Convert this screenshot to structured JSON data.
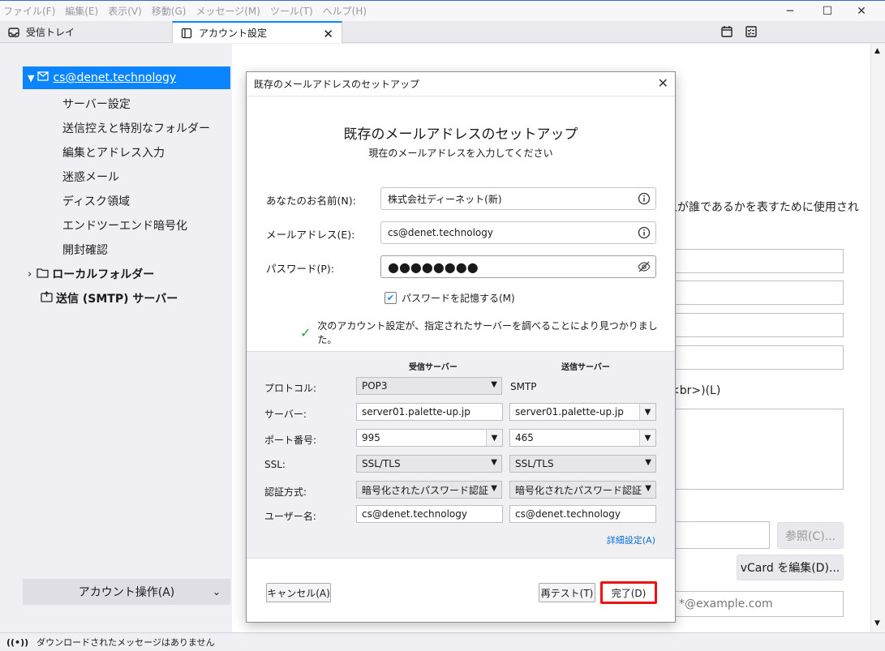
{
  "menu": [
    "ファイル(F)",
    "編集(E)",
    "表示(V)",
    "移動(G)",
    "メッセージ(M)",
    "ツール(T)",
    "ヘルプ(H)"
  ],
  "tabs": [
    {
      "label": "受信トレイ"
    },
    {
      "label": "アカウント設定"
    }
  ],
  "sidebar": {
    "account": "cs@denet.technology",
    "items": [
      "サーバー設定",
      "送信控えと特別なフォルダー",
      "編集とアドレス入力",
      "迷惑メール",
      "ディスク領域",
      "エンドツーエンド暗号化",
      "開封確認"
    ],
    "local_folders": "ローカルフォルダー",
    "smtp": "送信 (SMTP) サーバー",
    "account_ops": "アカウント操作(A)"
  },
  "background": {
    "desc_fragment": "人が誰であるかを表すために使用され",
    "br_label": "<br>)(L)",
    "browse_button": "参照(C)...",
    "vcard_button": "vCard を編集(D)...",
    "email_placeholder": "*@example.com"
  },
  "status": "ダウンロードされたメッセージはありません",
  "dialog": {
    "title": "既存のメールアドレスのセットアップ",
    "heading": "既存のメールアドレスのセットアップ",
    "subheading": "現在のメールアドレスを入力してください",
    "name_label": "あなたのお名前(N):",
    "name_value": "株式会社ディーネット(新)",
    "email_label": "メールアドレス(E):",
    "email_value": "cs@denet.technology",
    "password_label": "パスワード(P):",
    "password_value": "●●●●●●●●",
    "remember_label": "パスワードを記憶する(M)",
    "remember_checked": true,
    "found_message": "次のアカウント設定が、指定されたサーバーを調べることにより見つかりました。",
    "server": {
      "incoming_header": "受信サーバー",
      "outgoing_header": "送信サーバー",
      "rows": {
        "protocol": {
          "label": "プロトコル:",
          "in": "POP3",
          "out": "SMTP"
        },
        "server": {
          "label": "サーバー:",
          "in": "server01.palette-up.jp",
          "out": "server01.palette-up.jp"
        },
        "port": {
          "label": "ポート番号:",
          "in": "995",
          "out": "465"
        },
        "ssl": {
          "label": "SSL:",
          "in": "SSL/TLS",
          "out": "SSL/TLS"
        },
        "auth": {
          "label": "認証方式:",
          "in": "暗号化されたパスワード認証",
          "out": "暗号化されたパスワード認証"
        },
        "user": {
          "label": "ユーザー名:",
          "in": "cs@denet.technology",
          "out": "cs@denet.technology"
        }
      },
      "advanced_link": "詳細設定(A)"
    },
    "buttons": {
      "cancel": "キャンセル(A)",
      "retest": "再テスト(T)",
      "done": "完了(D)"
    }
  },
  "colors": {
    "accent": "#0a84ff",
    "highlight_border": "#ee1111",
    "success": "#2ea043"
  }
}
